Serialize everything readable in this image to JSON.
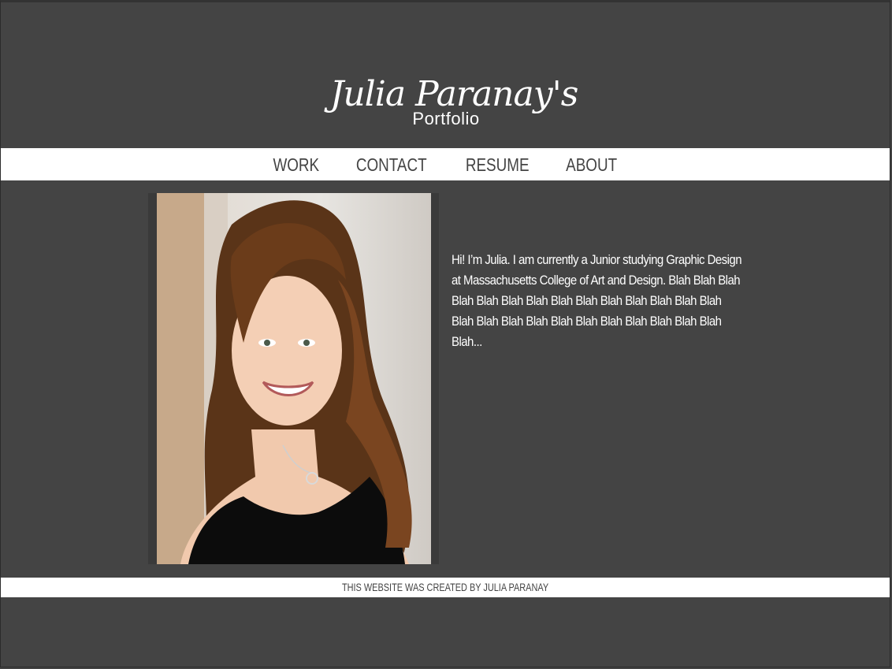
{
  "header": {
    "title": "Julia Paranay's",
    "subtitle": "Portfolio"
  },
  "nav": {
    "items": [
      {
        "label": "WORK"
      },
      {
        "label": "CONTACT"
      },
      {
        "label": "RESUME"
      },
      {
        "label": "ABOUT"
      }
    ]
  },
  "main": {
    "photo_alt": "Portrait photo of Julia Paranay",
    "about_text": "Hi! I’m Julia. I am currently a Junior studying Graphic Design at Massachusetts College of Art and Design.  Blah Blah Blah Blah Blah Blah Blah Blah Blah Blah Blah Blah Blah Blah Blah Blah Blah Blah Blah Blah Blah Blah Blah Blah Blah Blah..."
  },
  "footer": {
    "text": "THIS WEBSITE WAS CREATED BY JULIA PARANAY"
  },
  "colors": {
    "background": "#444444",
    "bar": "#ffffff",
    "text_light": "#ffffff",
    "text_dark": "#444444"
  }
}
